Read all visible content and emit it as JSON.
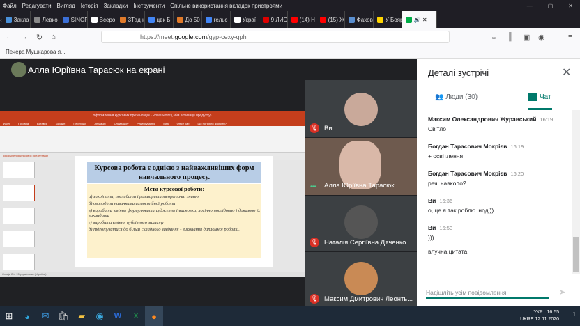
{
  "browser": {
    "menu": [
      "Файл",
      "Редагувати",
      "Вигляд",
      "Історія",
      "Закладки",
      "Інструменти",
      "Спільне використання вкладок пристроями"
    ],
    "tabs": [
      {
        "label": "Закла",
        "color": "#4a90d9"
      },
      {
        "label": "Левко",
        "color": "#888"
      },
      {
        "label": "SINOP",
        "color": "#3b6fd6"
      },
      {
        "label": "Всеро",
        "color": "#fff"
      },
      {
        "label": "3Тад н",
        "color": "#e07a2a"
      },
      {
        "label": "цвк Б",
        "color": "#4285f4"
      },
      {
        "label": "До 50",
        "color": "#e07a2a"
      },
      {
        "label": "гельс",
        "color": "#4285f4"
      },
      {
        "label": "Украї",
        "color": "#fff"
      },
      {
        "label": "9 ЛИС",
        "color": "#d00"
      },
      {
        "label": "(14) Н",
        "color": "#f00"
      },
      {
        "label": "(15) Ж",
        "color": "#f00"
      },
      {
        "label": "Фахов",
        "color": "#5a8fd0"
      },
      {
        "label": "У Бояр",
        "color": "#ffd500"
      }
    ],
    "active_tab_label": "🔊 ✕",
    "url_prefix": "https://meet.",
    "url_domain": "google.com",
    "url_path": "/gyp-cexy-qph",
    "bookmark": "Печера Мушкарова я..."
  },
  "meet": {
    "presenting": "Алла Юріївна Тарасюк на екрані",
    "ppt_title": "оформлення курсових презентацій - PowerPoint (Збій активації продукту)",
    "ppt_tabs": [
      "Файл",
      "Головна",
      "Вставка",
      "Дизайн",
      "Переходи",
      "Анімація",
      "Слайд-шоу",
      "Рецензування",
      "Вид",
      "Office Tab",
      "Що потрібно зробити?"
    ],
    "ppt_doc_tab": "оформлення курсових презентацій",
    "slide": {
      "heading": "Курсова робота є однією з найважливіших форм навчального процесу.",
      "subheading": "Мета курсової роботи:",
      "items": [
        "а) закріпити, поглибити і розширити теоретичні знання",
        "б) оволодіти навичками самостійної роботи",
        "в) виробити вміння формулювати судження і висновки, логічно послідовно і доказово їх викладати",
        "г) виробити вміння публічного захисту",
        "д) підготуватися до більш складного завдання - виконання дипломної роботи."
      ]
    },
    "ppt_status": "Слайд 2 із 15   українська (Україна)",
    "participants": [
      {
        "name": "Ви",
        "muted": true
      },
      {
        "name": "Алла Юріївна Тарасюк",
        "muted": false
      },
      {
        "name": "Наталія Сергіївна Дяченко",
        "muted": true
      },
      {
        "name": "Максим Дмитрович Леонть...",
        "muted": true
      }
    ]
  },
  "panel": {
    "title": "Деталі зустрічі",
    "people_tab": "Люди (30)",
    "chat_tab": "Чат",
    "messages": [
      {
        "author": "Максим Олександрович Журавський",
        "time": "16:19",
        "texts": [
          "Світло"
        ]
      },
      {
        "author": "Богдан Тарасович Мокрієв",
        "time": "16:19",
        "texts": [
          "+ освітлення"
        ]
      },
      {
        "author": "Богдан Тарасович Мокрієв",
        "time": "16:20",
        "texts": [
          "речі навколо?"
        ]
      },
      {
        "author": "Ви",
        "time": "16:36",
        "texts": [
          "о, це я так роблю іноді))"
        ]
      },
      {
        "author": "Ви",
        "time": "16:53",
        "texts": [
          ")))",
          "влучна цитата"
        ]
      }
    ],
    "input_placeholder": "Надішліть усім повідомлення"
  },
  "taskbar": {
    "lang1": "УКР",
    "lang2": "UKRE",
    "time": "16:55",
    "date": "12.11.2020",
    "notif": "1"
  },
  "colors": {
    "accent": "#00796b",
    "mute": "#d93025",
    "ppt": "#c43e1c"
  }
}
